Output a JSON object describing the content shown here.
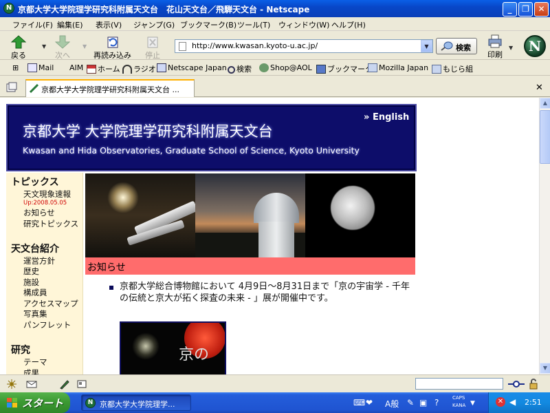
{
  "window": {
    "title": "京都大学大学院理学研究科附属天文台　花山天文台／飛騨天文台 - Netscape",
    "app_icon_letter": "N",
    "minimize_glyph": "_",
    "maximize_glyph": "❐",
    "close_glyph": "✕"
  },
  "menubar": {
    "items": [
      "ファイル(F)",
      "編集(E)",
      "表示(V)",
      "ジャンプ(G)",
      "ブックマーク(B)",
      "ツール(T)",
      "ウィンドウ(W)",
      "ヘルプ(H)"
    ]
  },
  "toolbar": {
    "back_label": "戻る",
    "forward_label": "次へ",
    "reload_label": "再読み込み",
    "stop_label": "停止",
    "url": "http://www.kwasan.kyoto-u.ac.jp/",
    "search_label": "検索",
    "print_label": "印刷",
    "logo_letter": "N"
  },
  "personal_toolbar": {
    "items": [
      "Mail",
      "AIM",
      "ホーム",
      "ラジオ",
      "Netscape Japan",
      "検索",
      "Shop@AOL",
      "ブックマーク",
      "Mozilla Japan",
      "もじら組"
    ]
  },
  "tabs": [
    {
      "label": "京都大学大学院理学研究科附属天文台 ..."
    }
  ],
  "tab_close_glyph": "✕",
  "page": {
    "banner": {
      "title_jp": "京都大学 大学院理学研究科附属天文台",
      "title_en": "Kwasan and Hida Observatories, Graduate School of Science, Kyoto University",
      "english_link": "English",
      "english_arrows": "»"
    },
    "left_nav": {
      "topics_heading": "トピックス",
      "topics_items": [
        "天文現象速報",
        "お知らせ",
        "研究トピックス"
      ],
      "update_date": "Up:2008.05.05",
      "intro_heading": "天文台紹介",
      "intro_items": [
        "運営方針",
        "歴史",
        "施設",
        "構成員",
        "アクセスマップ",
        "写真集",
        "パンフレット"
      ],
      "research_heading": "研究",
      "research_items": [
        "テーマ",
        "成果"
      ]
    },
    "notice_heading": "お知らせ",
    "news": [
      {
        "text": "京都大学総合博物館において 4月9日～8月31日まで「京の宇宙学 - 千年の伝統と京大が拓く探査の未来 - 」展が開催中です。"
      }
    ],
    "news_image_text": "京の"
  },
  "taskbar": {
    "start_label": "スタート",
    "task_label": "京都大学大学院理学...",
    "task_icon_letter": "N",
    "ime_mode": "A般",
    "caps": "CAPS",
    "kana": "KANA",
    "clock": "2:51"
  },
  "colors": {
    "banner_bg": "#0d0d6a",
    "nav_bg": "#fff6d8",
    "notice_bar": "#ff6c6c",
    "update_date": "#d00000"
  }
}
